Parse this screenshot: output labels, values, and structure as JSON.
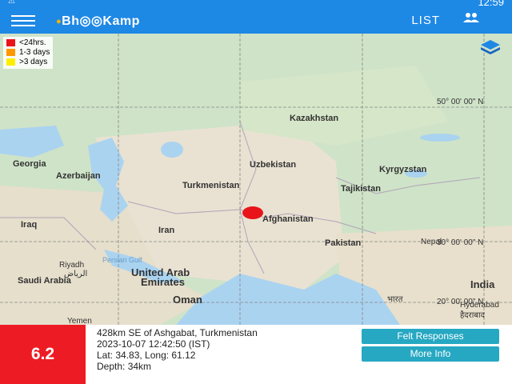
{
  "status": {
    "time": "12:59",
    "warning_icon": "warning-triangle-icon"
  },
  "appbar": {
    "menu_icon": "hamburger-menu-icon",
    "logo_text": "Bh◎◎Kamp",
    "list_label": "LIST",
    "users_icon": "users-icon",
    "bg": "#1e88e5"
  },
  "legend": [
    {
      "label": "<24hrs.",
      "color": "#e8141a"
    },
    {
      "label": "1-3 days",
      "color": "#ff9800"
    },
    {
      "label": ">3 days",
      "color": "#ffee00"
    }
  ],
  "map": {
    "countries": [
      "Kazakhstan",
      "Georgia",
      "Azerbaijan",
      "Uzbekistan",
      "Kyrgyzstan",
      "Turkmenistan",
      "Tajikistan",
      "Afghanistan",
      "Iraq",
      "Iran",
      "Pakistan",
      "Nepal",
      "Riyadh",
      "الرياض",
      "Saudi Arabia",
      "United Arab",
      "Emirates",
      "Oman",
      "India",
      "भारत",
      "Hyderabad",
      "हैदराबाद",
      "Yemen"
    ],
    "water": "Persian Gulf",
    "coords": [
      "50° 00' 00\" N",
      "30° 00' 00\" N",
      "20° 00' 00\" N"
    ],
    "layers_icon": "layers-icon"
  },
  "event": {
    "magnitude": "6.2",
    "location": "428km SE of Ashgabat, Turkmenistan",
    "datetime": "2023-10-07 12:42:50 (IST)",
    "latlong": "Lat: 34.83, Long: 61.12",
    "depth": "Depth: 34km",
    "felt_label": "Felt Responses",
    "more_label": "More Info"
  }
}
